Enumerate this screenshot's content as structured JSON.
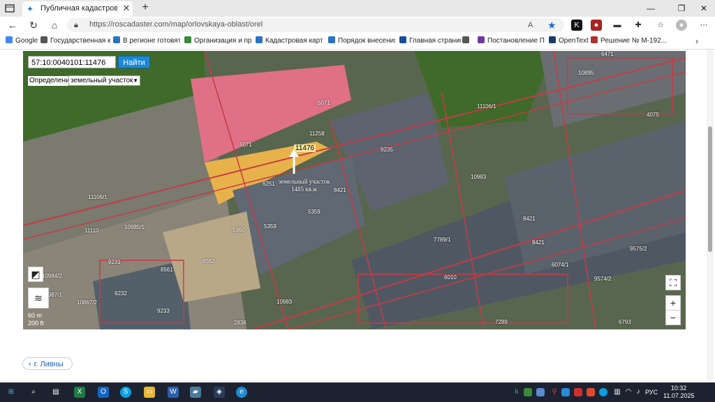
{
  "browser": {
    "tab_title": "Публичная кадастровая карта: г",
    "tab_close": "✕",
    "new_tab": "+",
    "url": "https://roscadaster.com/map/orlovskaya-oblast/orel",
    "window_controls": [
      "—",
      "❐",
      "✕"
    ]
  },
  "bookmarks": [
    {
      "label": "Google",
      "color": "#4285f4"
    },
    {
      "label": "Государственная к...",
      "color": "#555555"
    },
    {
      "label": "В регионе готовятс...",
      "color": "#2a72c8"
    },
    {
      "label": "Организация и про...",
      "color": "#3a8a3a"
    },
    {
      "label": "Кадастровая карта...",
      "color": "#2a72c8"
    },
    {
      "label": "Порядок внесения...",
      "color": "#2a72c8"
    },
    {
      "label": "Главная страница",
      "color": "#1a4a9a"
    },
    {
      "label": "Постановление Пр...",
      "color": "#6a3aa0"
    },
    {
      "label": "OpenText",
      "color": "#1a3a6a"
    },
    {
      "label": "Решение № М-192...",
      "color": "#b03030"
    }
  ],
  "map": {
    "search_value": "57:10:0040101:11476",
    "search_button": "Найти",
    "definition_label": "Определение:",
    "definition_value": "земельный участок",
    "selected_number": "11476",
    "annotation_line1": "земельный участок",
    "annotation_line2": "1485 кв.м",
    "scale_m": "60 m",
    "scale_ft": "200 ft",
    "zoom_in": "+",
    "zoom_out": "−",
    "parcels": [
      "5071",
      "5071",
      "11258",
      "9235",
      "11106/1",
      "10895",
      "4075",
      "6251",
      "8421",
      "5359",
      "5359",
      "5360",
      "11106/1",
      "11110",
      "10985/1",
      "9231",
      "8561",
      "8562",
      "9232",
      "9233",
      "2836",
      "10983",
      "10983",
      "7789/1",
      "6010",
      "8421",
      "8421",
      "6074/1",
      "9575/2",
      "9574/2",
      "6793",
      "7289",
      "10867/2",
      "10987/1",
      "10984/2",
      "6471"
    ]
  },
  "page": {
    "back_link": "г. Ливны",
    "back_chevron": "‹"
  },
  "taskbar": {
    "lang": "РУС",
    "time": "10:32",
    "date": "11.07.2025"
  }
}
